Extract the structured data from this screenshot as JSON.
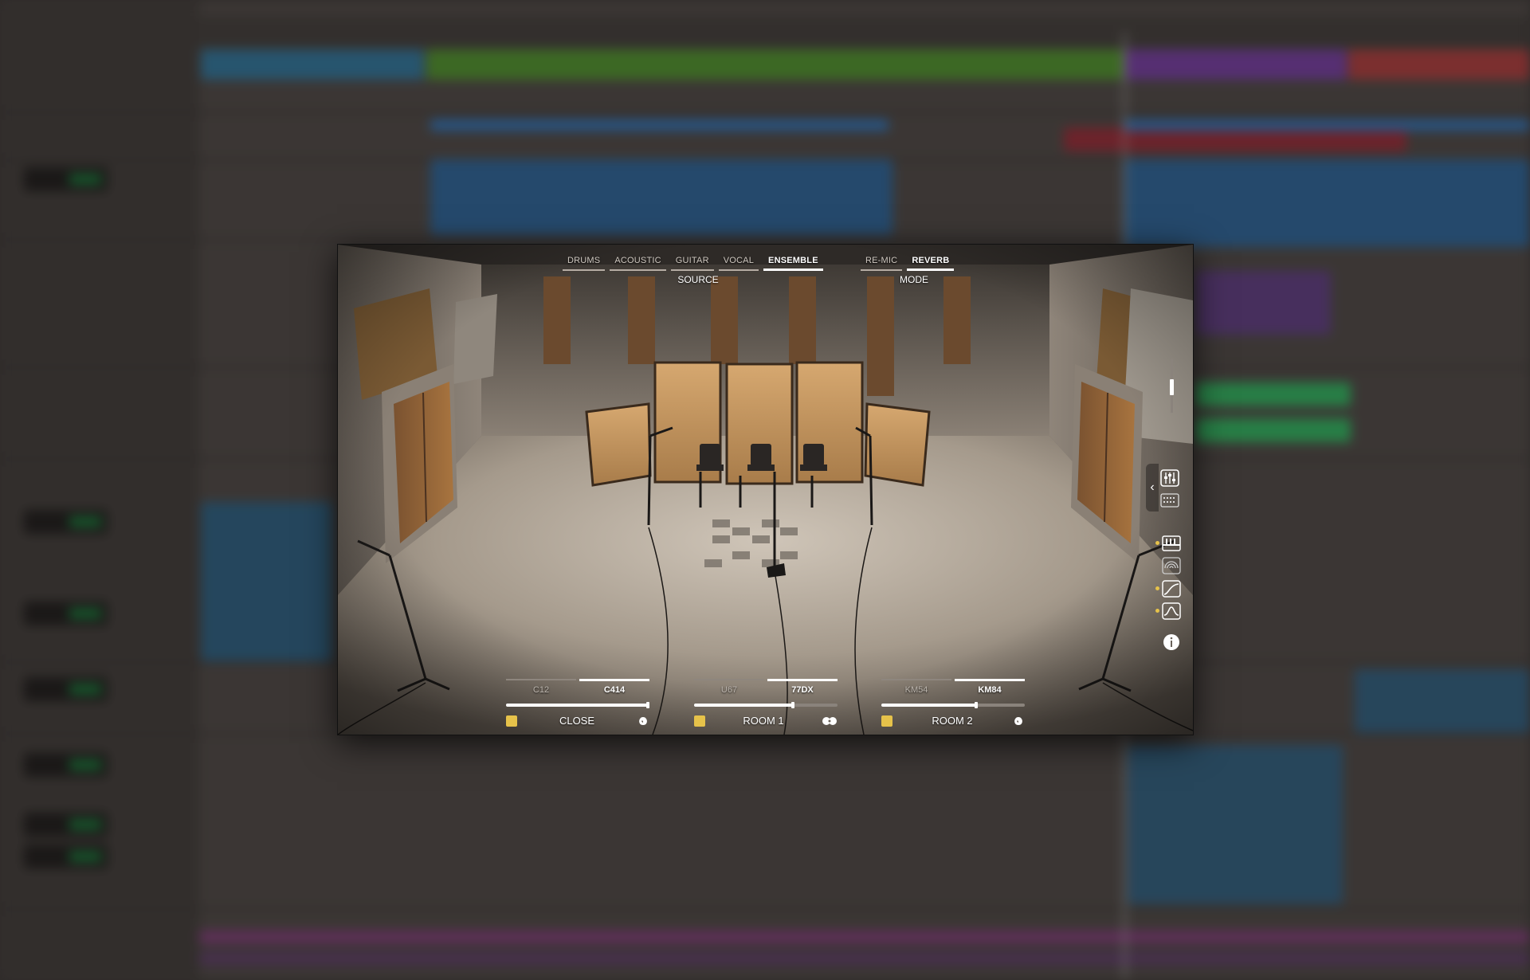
{
  "source_tabs": [
    {
      "label": "DRUMS",
      "active": false
    },
    {
      "label": "ACOUSTIC",
      "active": false
    },
    {
      "label": "GUITAR",
      "active": false
    },
    {
      "label": "VOCAL",
      "active": false
    },
    {
      "label": "ENSEMBLE",
      "active": true
    }
  ],
  "source_label": "SOURCE",
  "mode_tabs": [
    {
      "label": "RE-MIC",
      "active": false
    },
    {
      "label": "REVERB",
      "active": true
    }
  ],
  "mode_label": "MODE",
  "mics": [
    {
      "name": "CLOSE",
      "choices": [
        "C12",
        "C414"
      ],
      "selected": "C414",
      "level": 1.0,
      "enabled": true,
      "pattern": "cardioid"
    },
    {
      "name": "ROOM 1",
      "choices": [
        "U67",
        "77DX"
      ],
      "selected": "77DX",
      "level": 0.7,
      "enabled": true,
      "pattern": "figure-eight"
    },
    {
      "name": "ROOM 2",
      "choices": [
        "KM54",
        "KM84"
      ],
      "selected": "KM84",
      "level": 0.67,
      "enabled": true,
      "pattern": "cardioid"
    }
  ],
  "side_icons": [
    "chevron-left-icon",
    "mixer-icon",
    "keyboard-icon",
    "piano-icon",
    "rings-icon",
    "curve-icon",
    "eq-icon",
    "info-icon"
  ],
  "colors": {
    "accent_yellow": "#e6c24a",
    "active_white": "#ffffff",
    "inactive": "#bdb6ae"
  }
}
